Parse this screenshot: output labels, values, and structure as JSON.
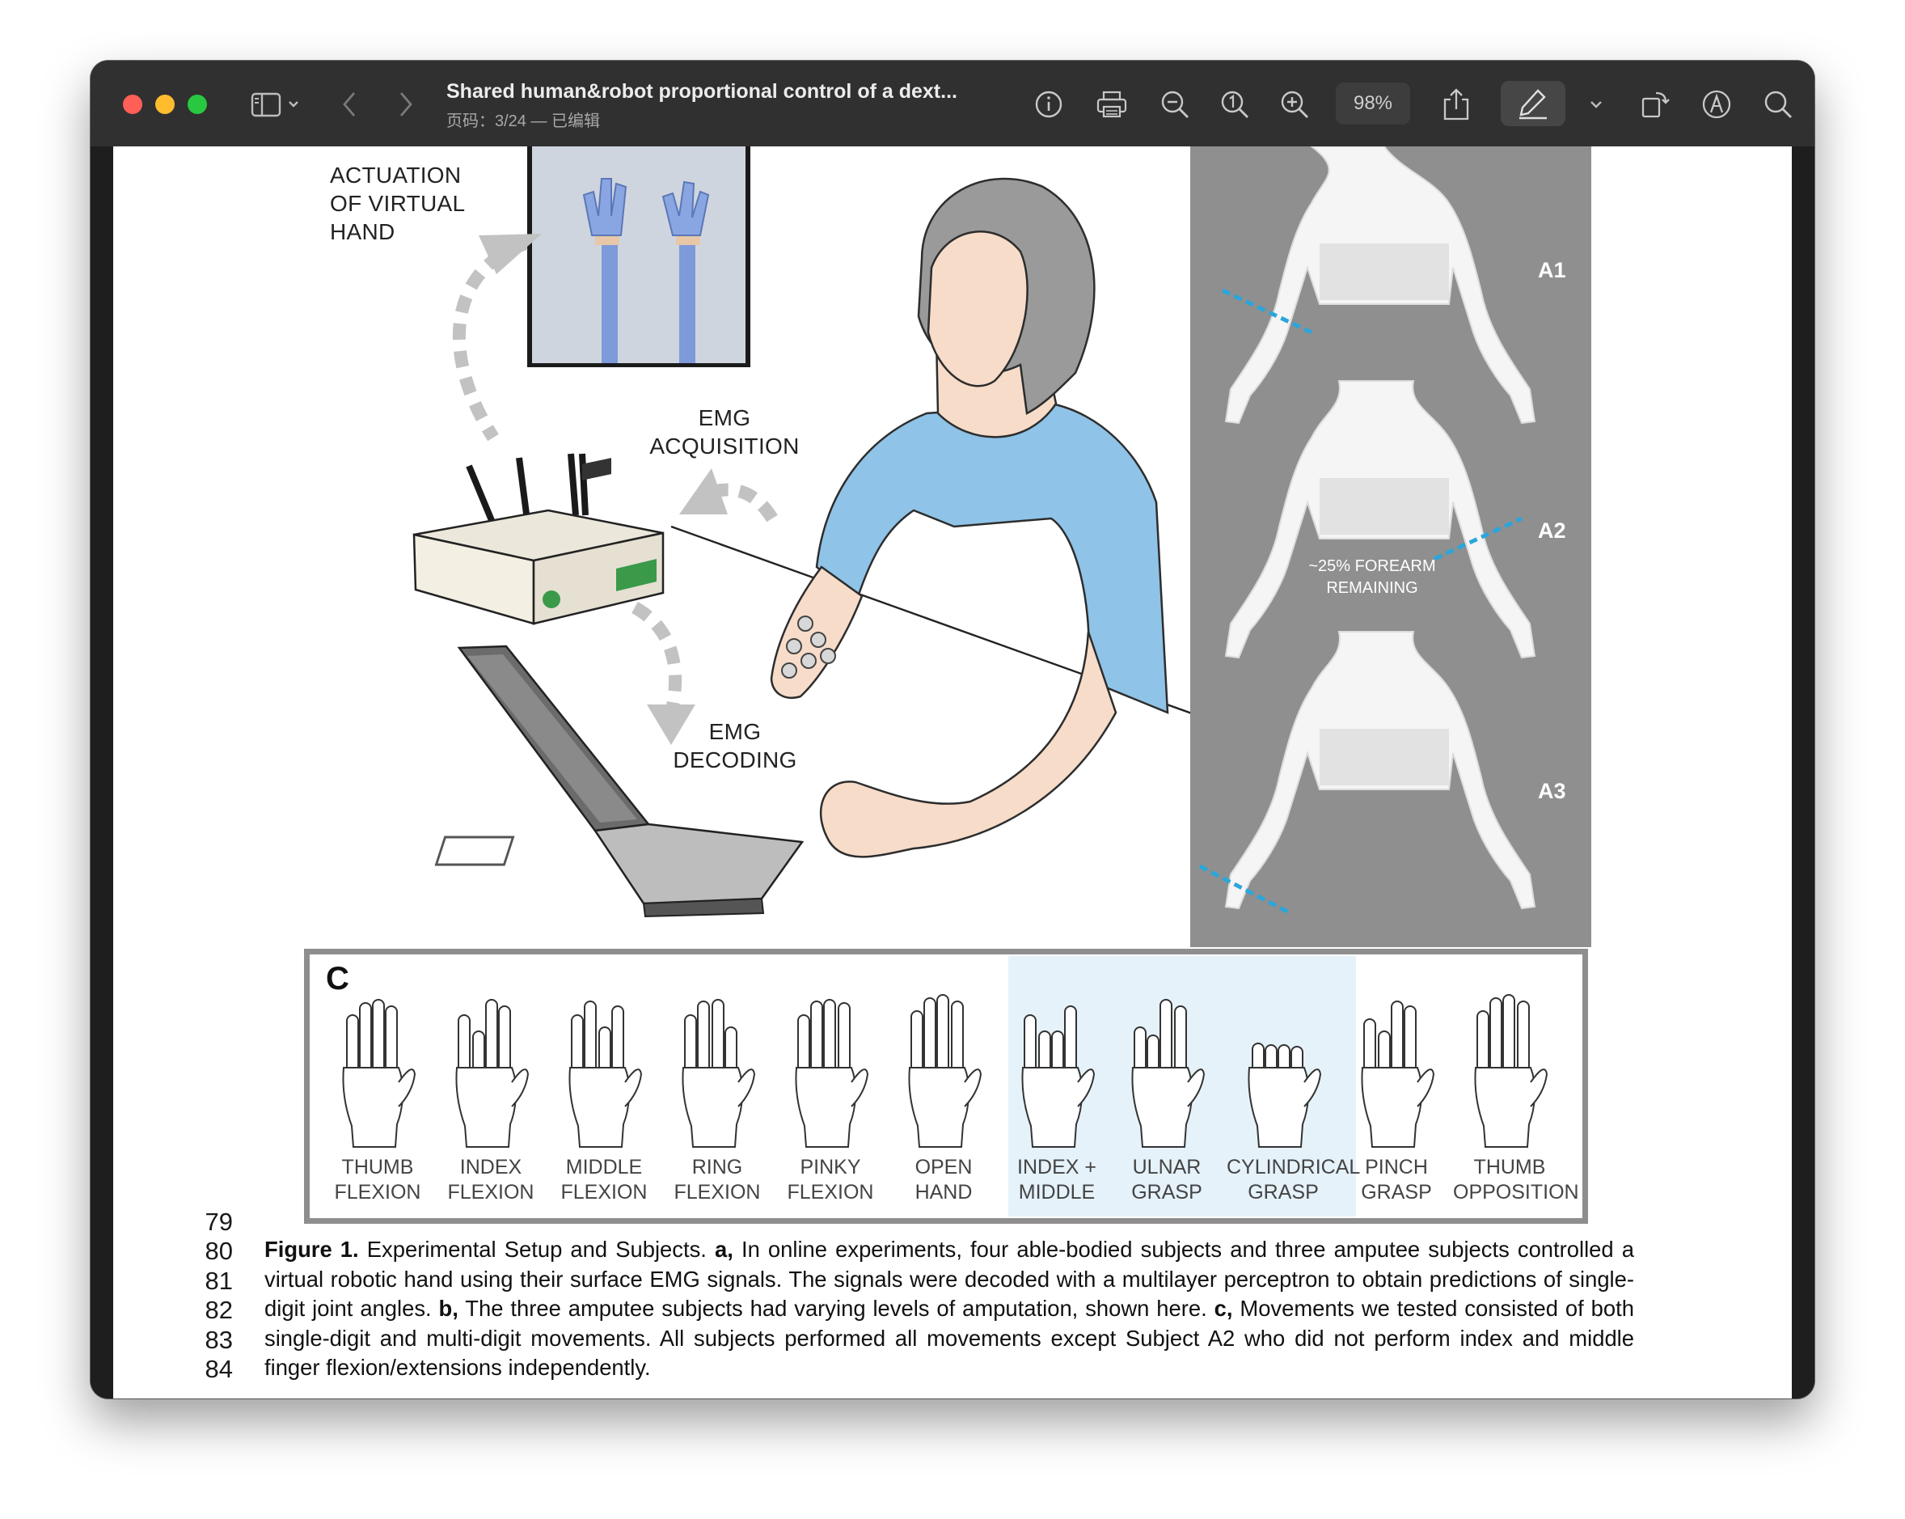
{
  "window": {
    "doc_title": "Shared human&robot proportional control of a dext...",
    "doc_subtitle": "页码：3/24 — 已编辑",
    "zoom": "98%",
    "toolbar_icons": [
      "sidebar-icon",
      "chevron-down-icon",
      "back-icon",
      "forward-icon",
      "info-icon",
      "print-icon",
      "zoom-out-icon",
      "actual-size-icon",
      "zoom-in-icon",
      "share-icon",
      "highlight-pen-icon",
      "chevron-down-icon",
      "rotate-icon",
      "markup-icon",
      "search-icon"
    ]
  },
  "figure_a": {
    "actuation_label": [
      "ACTUATION",
      "OF VIRTUAL",
      "HAND"
    ],
    "emg_acq_label": [
      "EMG",
      "ACQUISITION"
    ],
    "emg_dec_label": [
      "EMG",
      "DECODING"
    ]
  },
  "figure_b": {
    "subjects": [
      "A1",
      "A2",
      "A3"
    ],
    "a2_note": [
      "~25% FOREARM",
      "REMAINING"
    ],
    "colors": {
      "panel": "#8f8f8f",
      "cut_line": "#2aa6db"
    }
  },
  "figure_c": {
    "letter": "C",
    "movements": [
      {
        "l1": "THUMB",
        "l2": "FLEXION"
      },
      {
        "l1": "INDEX",
        "l2": "FLEXION"
      },
      {
        "l1": "MIDDLE",
        "l2": "FLEXION"
      },
      {
        "l1": "RING",
        "l2": "FLEXION"
      },
      {
        "l1": "PINKY",
        "l2": "FLEXION"
      },
      {
        "l1": "OPEN",
        "l2": "HAND"
      },
      {
        "l1": "INDEX +",
        "l2": "MIDDLE"
      },
      {
        "l1": "ULNAR",
        "l2": "GRASP"
      },
      {
        "l1": "CYLINDRICAL",
        "l2": "GRASP"
      },
      {
        "l1": "PINCH",
        "l2": "GRASP"
      },
      {
        "l1": "THUMB",
        "l2": "OPPOSITION"
      }
    ],
    "highlight_color": "#e5f2fa"
  },
  "line_numbers": [
    "79",
    "80",
    "81",
    "82",
    "83",
    "84"
  ],
  "caption": {
    "title": "Figure 1.",
    "intro": " Experimental Setup and Subjects. ",
    "a_label": "a,",
    "a_text": " In online experiments, four able-bodied subjects and three amputee subjects controlled a virtual robotic hand using their surface EMG signals. The signals were decoded with a multilayer perceptron to obtain predictions of single-digit joint angles. ",
    "b_label": "b,",
    "b_text": " The three amputee subjects had varying levels of amputation, shown here. ",
    "c_label": "c,",
    "c_text": " Movements we tested consisted of both single-digit and multi-digit movements. All subjects performed all movements except Subject A2 who did not perform index and middle finger flexion/extensions independently."
  }
}
